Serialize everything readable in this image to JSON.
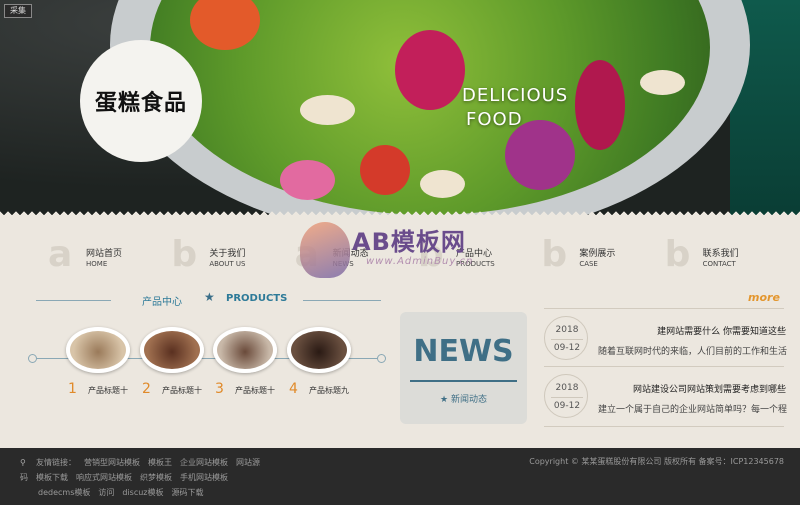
{
  "hero": {
    "tag_button": "采集",
    "logo_text": "蛋糕食品",
    "title_line1": "DELICIOUS",
    "title_line2": "FOOD"
  },
  "nav": [
    {
      "zh": "网站首页",
      "en": "HOME"
    },
    {
      "zh": "关于我们",
      "en": "ABOUT US"
    },
    {
      "zh": "新闻动态",
      "en": "NEWS"
    },
    {
      "zh": "产品中心",
      "en": "PRODUCTS"
    },
    {
      "zh": "案例展示",
      "en": "CASE"
    },
    {
      "zh": "联系我们",
      "en": "CONTACT"
    }
  ],
  "watermark": {
    "brand": "AB模板网",
    "url": "www.AdminBuy.cn"
  },
  "products": {
    "heading_zh": "产品中心",
    "star": "★",
    "heading_en": "PRODUCTS",
    "items": [
      {
        "num": "1",
        "label": "产品标题十"
      },
      {
        "num": "2",
        "label": "产品标题十"
      },
      {
        "num": "3",
        "label": "产品标题十"
      },
      {
        "num": "4",
        "label": "产品标题九"
      }
    ]
  },
  "news_box": {
    "title": "NEWS",
    "subtitle": "★ 新闻动态"
  },
  "news": {
    "more": "more",
    "items": [
      {
        "year": "2018",
        "md": "09-12",
        "title": "建网站需要什么 你需要知道这些",
        "desc": "随着互联网时代的来临，人们目前的工作和生活"
      },
      {
        "year": "2018",
        "md": "09-12",
        "title": "网站建设公司网站策划需要考虑到哪些",
        "desc": "建立一个属于自己的企业网站简单吗？每一个程"
      }
    ]
  },
  "footer": {
    "links": [
      "友情链接：",
      "营销型网站模板",
      "模板王",
      "企业网站模板",
      "网站源",
      "码",
      "模板下载",
      "响应式网站模板",
      "织梦模板",
      "手机网站模板",
      "dedecms模板",
      "访问",
      "discuz模板",
      "源码下载"
    ],
    "copyright": "Copyright © 某某蛋糕股份有限公司 版权所有 备案号：ICP12345678"
  },
  "colors": {
    "accent_blue": "#3f6f86",
    "accent_orange": "#e3962e",
    "bg": "#ece7df",
    "footer_bg": "#2a2a2a"
  }
}
